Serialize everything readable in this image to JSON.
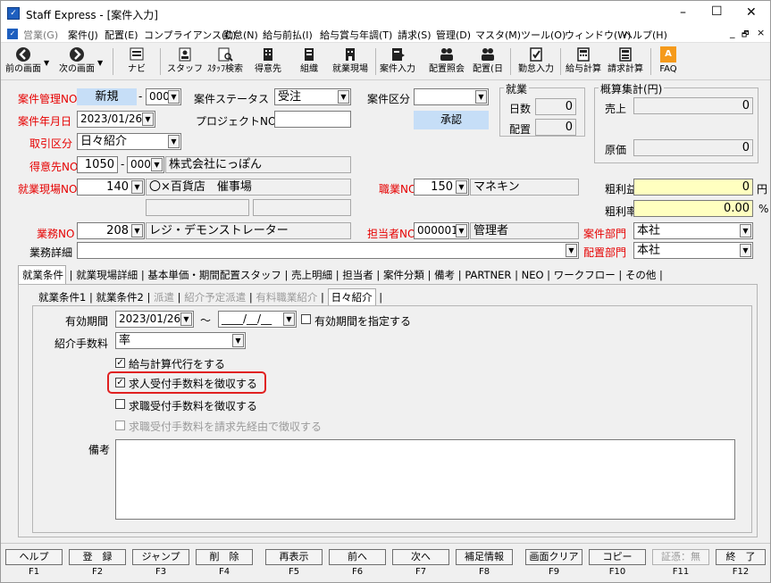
{
  "window": {
    "title": "Staff Express - [案件入力]",
    "min": "–",
    "max": "☐",
    "close": "✕"
  },
  "menu": {
    "items": [
      "営業(G)",
      "案件(J)",
      "配置(E)",
      "コンプライアンス(C)",
      "勤怠(N)",
      "給与前払(I)",
      "給与賞与年調(T)",
      "請求(S)",
      "管理(D)",
      "マスタ(M)",
      "ツール(O)",
      "ウィンドウ(W)",
      "ヘルプ(H)"
    ],
    "mdi_controls": [
      "_",
      "🗗",
      "×"
    ]
  },
  "toolbar": {
    "items": [
      {
        "label": "前の画面",
        "icon": "back-arrow-icon"
      },
      {
        "label": "次の画面",
        "icon": "forward-arrow-icon"
      },
      {
        "label": "ナビ",
        "icon": "navi-icon"
      },
      {
        "label": "スタッフ",
        "icon": "staff-icon"
      },
      {
        "label": "ｽﾀｯﾌ検索",
        "icon": "staff-search-icon"
      },
      {
        "label": "得意先",
        "icon": "customer-icon"
      },
      {
        "label": "組織",
        "icon": "organization-icon"
      },
      {
        "label": "就業現場",
        "icon": "worksite-icon"
      },
      {
        "label": "案件入力",
        "icon": "case-entry-icon"
      },
      {
        "label": "配置照会",
        "icon": "placement-inquiry-icon"
      },
      {
        "label": "配置(日",
        "icon": "placement-daily-icon"
      },
      {
        "label": "勤怠入力",
        "icon": "attendance-entry-icon"
      },
      {
        "label": "給与計算",
        "icon": "payroll-calc-icon"
      },
      {
        "label": "請求計算",
        "icon": "billing-calc-icon"
      },
      {
        "label": "FAQ",
        "icon": "faq-icon"
      }
    ]
  },
  "form": {
    "case_no_label": "案件管理NO",
    "case_no_value": "新規",
    "case_no_branch": "000",
    "case_status_label": "案件ステータス",
    "case_status_value": "受注",
    "case_category_label": "案件区分",
    "case_category_value": "",
    "approve_button": "承認",
    "case_date_label": "案件年月日",
    "case_date_value": "2023/01/26",
    "project_no_label": "プロジェクトNO",
    "project_no_value": "",
    "trade_label": "取引区分",
    "trade_value": "日々紹介",
    "customer_label": "得意先NO",
    "customer_no": "1050",
    "customer_branch": "000",
    "customer_name": "株式会社にっぽん",
    "worksite_label": "就業現場NO",
    "worksite_no": "140",
    "worksite_name": "〇×百貨店　催事場",
    "occupation_label": "職業NO",
    "occupation_no": "150",
    "occupation_name": "マネキン",
    "business_label": "業務NO",
    "business_no": "208",
    "business_name": "レジ・デモンストレーター",
    "staff_label": "担当者NO",
    "staff_no": "000001",
    "staff_name": "管理者",
    "dept_label": "案件部門",
    "dept_value": "本社",
    "business_detail_label": "業務詳細",
    "business_detail_value": "",
    "assign_dept_label": "配置部門",
    "assign_dept_value": "本社"
  },
  "employment": {
    "title": "就業",
    "days_label": "日数",
    "days_value": "0",
    "placement_label": "配置",
    "placement_value": "0"
  },
  "estimate": {
    "title": "概算集計(円)",
    "sales_label": "売上",
    "sales_value": "0",
    "cost_label": "原価",
    "cost_value": "0",
    "gross_profit_label": "粗利益",
    "gross_profit_value": "0",
    "gross_profit_unit": "円",
    "gross_rate_label": "粗利率",
    "gross_rate_value": "0.00",
    "gross_rate_unit": "%"
  },
  "tabs": [
    "就業条件",
    "就業現場詳細",
    "基本単価・期間配置スタッフ",
    "売上明細",
    "担当者",
    "案件分類",
    "備考",
    "PARTNER",
    "NEO",
    "ワークフロー",
    "その他"
  ],
  "subtabs": [
    {
      "label": "就業条件1",
      "enabled": true
    },
    {
      "label": "就業条件2",
      "enabled": true
    },
    {
      "label": "派遣",
      "enabled": false
    },
    {
      "label": "紹介予定派遣",
      "enabled": false
    },
    {
      "label": "有料職業紹介",
      "enabled": false
    },
    {
      "label": "日々紹介",
      "enabled": true
    }
  ],
  "detail": {
    "valid_period_label": "有効期間",
    "valid_from": "2023/01/26",
    "tilde": "～",
    "valid_to": "____/__/__",
    "specify_period_label": "有効期間を指定する",
    "fee_label": "紹介手数料",
    "fee_value": "率",
    "checkboxes": [
      {
        "label": "給与計算代行をする",
        "checked": true,
        "enabled": true
      },
      {
        "label": "求人受付手数料を徴収する",
        "checked": true,
        "enabled": true
      },
      {
        "label": "求職受付手数料を徴収する",
        "checked": false,
        "enabled": true
      },
      {
        "label": "求職受付手数料を請求先経由で徴収する",
        "checked": false,
        "enabled": false
      }
    ],
    "remarks_label": "備考",
    "remarks_value": ""
  },
  "fkeys": [
    {
      "label": "ヘルプ",
      "key": "F1",
      "enabled": true
    },
    {
      "label": "登　録",
      "key": "F2",
      "enabled": true
    },
    {
      "label": "ジャンプ",
      "key": "F3",
      "enabled": true
    },
    {
      "label": "削　除",
      "key": "F4",
      "enabled": true
    },
    {
      "label": "再表示",
      "key": "F5",
      "enabled": true
    },
    {
      "label": "前へ",
      "key": "F6",
      "enabled": true
    },
    {
      "label": "次へ",
      "key": "F7",
      "enabled": true
    },
    {
      "label": "補足情報",
      "key": "F8",
      "enabled": true
    },
    {
      "label": "画面クリア",
      "key": "F9",
      "enabled": true
    },
    {
      "label": "コピー",
      "key": "F10",
      "enabled": true
    },
    {
      "label": "証憑：無",
      "key": "F11",
      "enabled": false
    },
    {
      "label": "終　了",
      "key": "F12",
      "enabled": true
    }
  ],
  "colors": {
    "highlight": "#e02020",
    "required_label": "#e60000",
    "field_blue": "#c6def7",
    "field_yellow": "#ffffc0"
  }
}
